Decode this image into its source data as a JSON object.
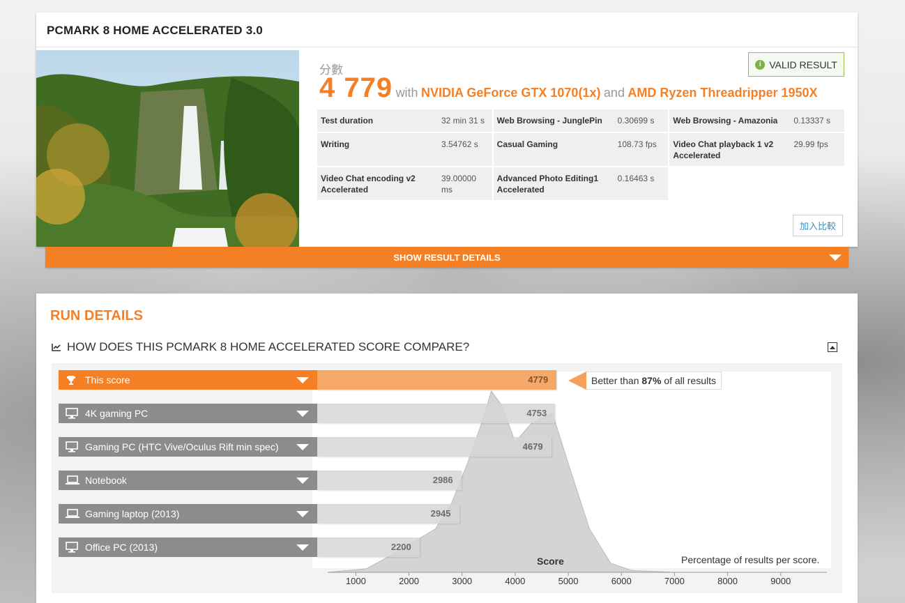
{
  "result": {
    "title": "PCMARK 8 HOME ACCELERATED 3.0",
    "score_label": "分數",
    "score": "4 779",
    "with_text": "with",
    "gpu": "NVIDIA GeForce GTX 1070(1x)",
    "and_text": "and",
    "cpu": "AMD Ryzen Threadripper 1950X",
    "valid_label": "VALID RESULT",
    "compare_label": "加入比較",
    "show_details_label": "SHOW RESULT DETAILS",
    "metrics": [
      {
        "name": "Test duration",
        "value": "32 min 31 s"
      },
      {
        "name": "Web Browsing - JunglePin",
        "value": "0.30699 s"
      },
      {
        "name": "Web Browsing - Amazonia",
        "value": "0.13337 s"
      },
      {
        "name": "Writing",
        "value": "3.54762 s"
      },
      {
        "name": "Casual Gaming",
        "value": "108.73 fps"
      },
      {
        "name": "Video Chat playback 1 v2 Accelerated",
        "value": "29.99 fps"
      },
      {
        "name": "Video Chat encoding v2 Accelerated",
        "value": "39.00000 ms"
      },
      {
        "name": "Advanced Photo Editing1 Accelerated",
        "value": "0.16463 s"
      }
    ]
  },
  "run_details": {
    "title": "RUN DETAILS",
    "compare_heading": "HOW DOES THIS PCMARK 8 HOME ACCELERATED SCORE COMPARE?",
    "better_prefix": "Better than",
    "better_pct": "87%",
    "better_suffix": "of all results",
    "x_axis_label": "Score",
    "y_axis_note": "Percentage of results per score.",
    "bars": [
      {
        "label": "This score",
        "value": 4779,
        "value_text": "4779",
        "icon": "trophy-icon",
        "color": "#f47f24",
        "fill": "#f6a460"
      },
      {
        "label": "4K gaming PC",
        "value": 4753,
        "value_text": "4753",
        "icon": "desktop-icon",
        "color": "#8c8c8c",
        "fill": "#d6d6d6"
      },
      {
        "label": "Gaming PC (HTC Vive/Oculus Rift min spec)",
        "value": 4679,
        "value_text": "4679",
        "icon": "desktop-icon",
        "color": "#8c8c8c",
        "fill": "#d6d6d6"
      },
      {
        "label": "Notebook",
        "value": 2986,
        "value_text": "2986",
        "icon": "laptop-icon",
        "color": "#8c8c8c",
        "fill": "#d6d6d6"
      },
      {
        "label": "Gaming laptop (2013)",
        "value": 2945,
        "value_text": "2945",
        "icon": "laptop-icon",
        "color": "#8c8c8c",
        "fill": "#d6d6d6"
      },
      {
        "label": "Office PC (2013)",
        "value": 2200,
        "value_text": "2200",
        "icon": "desktop-icon",
        "color": "#8c8c8c",
        "fill": "#d6d6d6"
      }
    ]
  },
  "chart_data": {
    "type": "area",
    "xlabel": "Score",
    "ylabel": "Percentage of results per score.",
    "xlim": [
      470,
      9870
    ],
    "x_ticks": [
      1000,
      2000,
      3000,
      4000,
      5000,
      6000,
      7000,
      8000,
      9000
    ],
    "x": [
      470,
      1200,
      1700,
      2100,
      2500,
      2800,
      3100,
      3400,
      3550,
      3750,
      4000,
      4300,
      4700,
      5000,
      5400,
      5800,
      6200,
      7000,
      8000,
      9870
    ],
    "y": [
      0,
      2,
      10,
      17,
      24,
      38,
      60,
      85,
      100,
      92,
      72,
      82,
      88,
      60,
      24,
      5,
      1,
      0,
      0,
      0
    ]
  }
}
